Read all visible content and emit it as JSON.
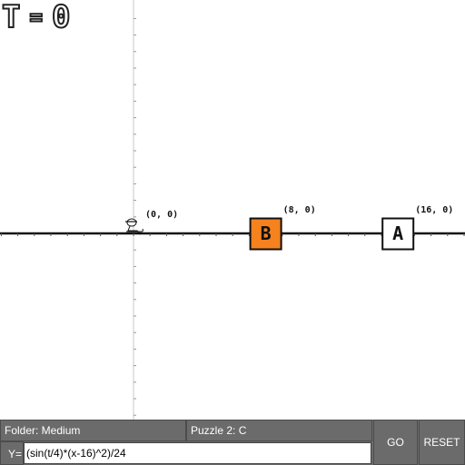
{
  "hud": {
    "time_label": "T",
    "equals": "=",
    "time_value": "0"
  },
  "graph": {
    "origin_label": "(0, 0)",
    "axis_x_range": [
      -16,
      20
    ],
    "axis_y_range": [
      -20,
      13
    ]
  },
  "targets": [
    {
      "id": "B",
      "label": "B",
      "coord_label": "(8, 0)",
      "x": 8,
      "y": 0,
      "fill": "#f5821f",
      "state": "active"
    },
    {
      "id": "A",
      "label": "A",
      "coord_label": "(16, 0)",
      "x": 16,
      "y": 0,
      "fill": "#ffffff",
      "state": "pending"
    }
  ],
  "character": {
    "icon": "sled-rider-icon",
    "x": 0,
    "y": 0
  },
  "controls": {
    "folder": "Folder: Medium",
    "puzzle": "Puzzle 2: C",
    "equation_prefix": "Y=",
    "equation_value": "(sin(t/4)*(x-16)^2)/24",
    "go_label": "GO",
    "reset_label": "RESET"
  },
  "colors": {
    "active_target": "#f5821f",
    "bar": "#6b6b6b",
    "axis": "#111111"
  }
}
